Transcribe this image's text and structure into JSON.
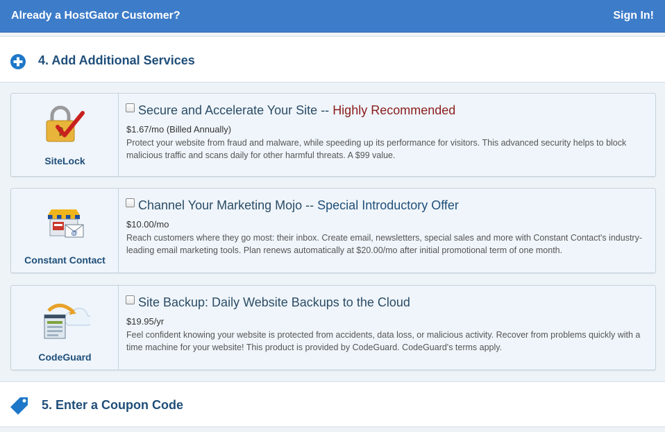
{
  "topbar": {
    "question": "Already a HostGator Customer?",
    "sign_in": "Sign In!"
  },
  "section4": {
    "title": "4. Add Additional Services",
    "icon": "plus-circle-icon"
  },
  "section5": {
    "title": "5. Enter a Coupon Code",
    "icon": "tag-icon"
  },
  "services": [
    {
      "logo_name": "SiteLock",
      "icon": "padlock-checkmark-icon",
      "headline_main": "Secure and Accelerate Your Site",
      "headline_sep": " -- ",
      "headline_highlight": "Highly Recommended",
      "price": "$1.67/mo (Billed Annually)",
      "description": "Protect your website from fraud and malware, while speeding up its performance for visitors. This advanced security helps to block malicious traffic and scans daily for other harmful threats. A $99 value."
    },
    {
      "logo_name": "Constant Contact",
      "icon": "storefront-email-icon",
      "headline_main": "Channel Your Marketing Mojo",
      "headline_sep": " -- ",
      "headline_highlight": "Special Introductory Offer",
      "price": "$10.00/mo",
      "description": "Reach customers where they go most: their inbox. Create email, newsletters, special sales and more with Constant Contact's industry-leading email marketing tools. Plan renews automatically at $20.00/mo after initial promotional term of one month."
    },
    {
      "logo_name": "CodeGuard",
      "icon": "cloud-backup-icon",
      "headline_main": "Site Backup: Daily Website Backups to the Cloud",
      "price": "$19.95/yr",
      "description": "Feel confident knowing your website is protected from accidents, data loss, or malicious activity. Recover from problems quickly with a time machine for your website! This product is provided by CodeGuard. CodeGuard's terms apply."
    }
  ],
  "colors": {
    "topbar": "#3d7cc9",
    "heading": "#1f4e79",
    "highlight_red": "#8b1c1c",
    "card_bg": "#eff5fa"
  }
}
